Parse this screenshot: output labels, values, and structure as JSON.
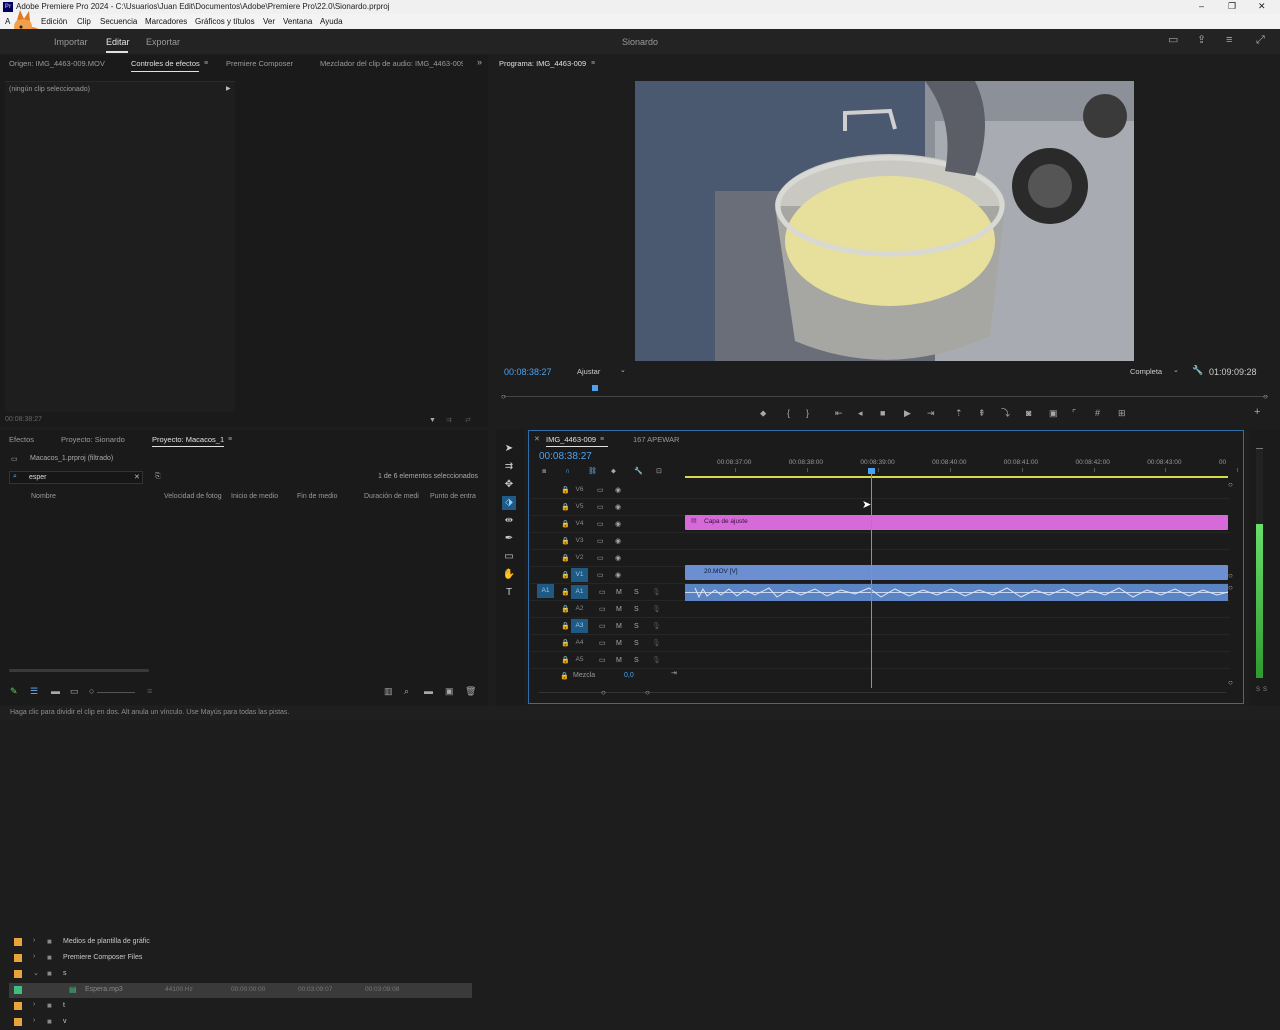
{
  "title_bar": {
    "title": "Adobe Premiere Pro 2024 - C:\\Usuarios\\Juan Edit\\Documentos\\Adobe\\Premiere Pro\\22.0\\Sionardo.prproj",
    "app_logo": "Pr"
  },
  "menu": [
    "A",
    "Edición",
    "Clip",
    "Secuencia",
    "Marcadores",
    "Gráficos y títulos",
    "Ver",
    "Ventana",
    "Ayuda"
  ],
  "workspace": {
    "tabs": [
      "Importar",
      "Editar",
      "Exportar"
    ],
    "active_tab": "Editar",
    "project_name": "Sionardo"
  },
  "source_panel": {
    "tabs": [
      "Origen: IMG_4463-009.MOV",
      "Controles de efectos",
      "Premiere Composer",
      "Mezclador del clip de audio: IMG_4463-009"
    ],
    "active_tab": "Controles de efectos",
    "no_clip": "(ningún clip seleccionado)",
    "timecode": "00:08:38:27"
  },
  "program_panel": {
    "tab": "Programa: IMG_4463-009",
    "timecode": "00:08:38:27",
    "fit": "Ajustar",
    "quality": "Completa",
    "duration": "01:09:09:28"
  },
  "project_panel": {
    "tabs": [
      "Efectos",
      "Proyecto: Sionardo",
      "Proyecto: Macacos_1"
    ],
    "active_tab": "Proyecto: Macacos_1",
    "path": "Macacos_1.prproj (filtrado)",
    "search_value": "esper",
    "count": "1 de 6 elementos seleccionados",
    "columns": [
      "Nombre",
      "Velocidad de fotog",
      "Inicio de medio",
      "Fin de medio",
      "Duración de medi",
      "Punto de entra"
    ],
    "items": [
      {
        "label_color": "#e8a33d",
        "name": "Medios de plantilla de gráfic",
        "type": "folder",
        "indent": 0,
        "fps": "",
        "start": "",
        "end": "",
        "dur": ""
      },
      {
        "label_color": "#e8a33d",
        "name": "Premiere Composer Files",
        "type": "folder",
        "indent": 0,
        "fps": "",
        "start": "",
        "end": "",
        "dur": ""
      },
      {
        "label_color": "#e8a33d",
        "name": "s",
        "type": "folder-open",
        "indent": 0,
        "fps": "",
        "start": "",
        "end": "",
        "dur": ""
      },
      {
        "label_color": "#3fbf7f",
        "name": "Espera.mp3",
        "type": "audio",
        "indent": 1,
        "fps": "44100 Hz",
        "start": "00:00:00:00",
        "end": "00:03:09:07",
        "dur": "00:03:09:08",
        "selected": true
      },
      {
        "label_color": "#e8a33d",
        "name": "t",
        "type": "folder",
        "indent": 0,
        "fps": "",
        "start": "",
        "end": "",
        "dur": ""
      },
      {
        "label_color": "#e8a33d",
        "name": "v",
        "type": "folder",
        "indent": 0,
        "fps": "",
        "start": "",
        "end": "",
        "dur": ""
      }
    ]
  },
  "timeline": {
    "tabs": [
      "IMG_4463-009",
      "167 APEWAR"
    ],
    "timecode": "00:08:38:27",
    "ruler": [
      "00:08:37:00",
      "00:08:38:00",
      "00:08:39:00",
      "00:08:40:00",
      "00:08:41:00",
      "00:08:42:00",
      "00:08:43:00",
      "00"
    ],
    "video_tracks": [
      "V6",
      "V5",
      "V4",
      "V3",
      "V2",
      "V1"
    ],
    "audio_tracks": [
      "A1",
      "A2",
      "A3",
      "A4",
      "A5"
    ],
    "source_patch": "A1",
    "mix_label": "Mezcla",
    "mix_value": "0,0",
    "clips": {
      "adjustment": "Capa de ajuste",
      "video": "20.MOV [V]"
    },
    "colors": {
      "adjustment": "#d56ad8",
      "video": "#6b8fd0",
      "audio": "#5b84c4",
      "playhead": "#4aa3f0"
    }
  },
  "meter_labels": [
    "S",
    "S"
  ],
  "status_bar": "Haga clic para dividir el clip en dos. Alt anula un vínculo. Use Mayús para todas las pistas."
}
